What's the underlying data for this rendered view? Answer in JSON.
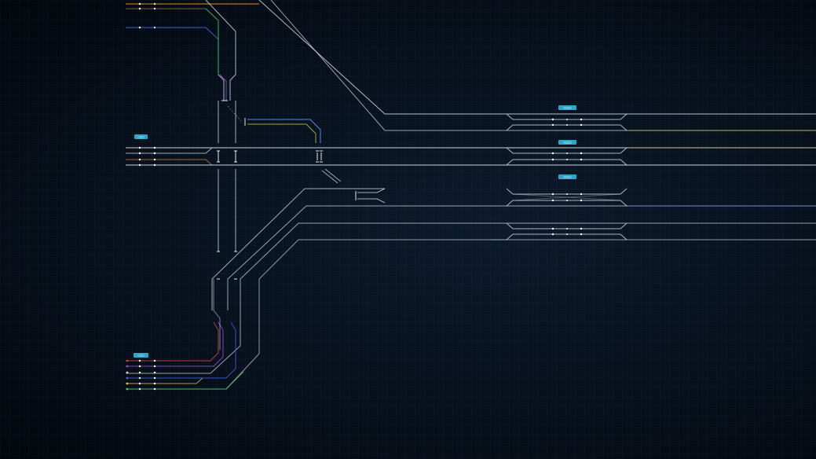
{
  "colors": {
    "background": "#050a14",
    "track_white": "#c8d2dc",
    "track_orange": "#e08a2a",
    "track_blue": "#3a5ad0",
    "track_green": "#3cc060",
    "track_yellow": "#d8c040",
    "track_purple": "#8a4ad0",
    "track_red": "#d04040",
    "platform_tag": "#2aa6c8",
    "signal_dot": "#ffffff"
  },
  "platform_labels": [
    {
      "text": "□□□□"
    },
    {
      "text": "□□□□"
    },
    {
      "text": "□□□□"
    },
    {
      "text": "□□□"
    },
    {
      "text": "□□□"
    }
  ]
}
